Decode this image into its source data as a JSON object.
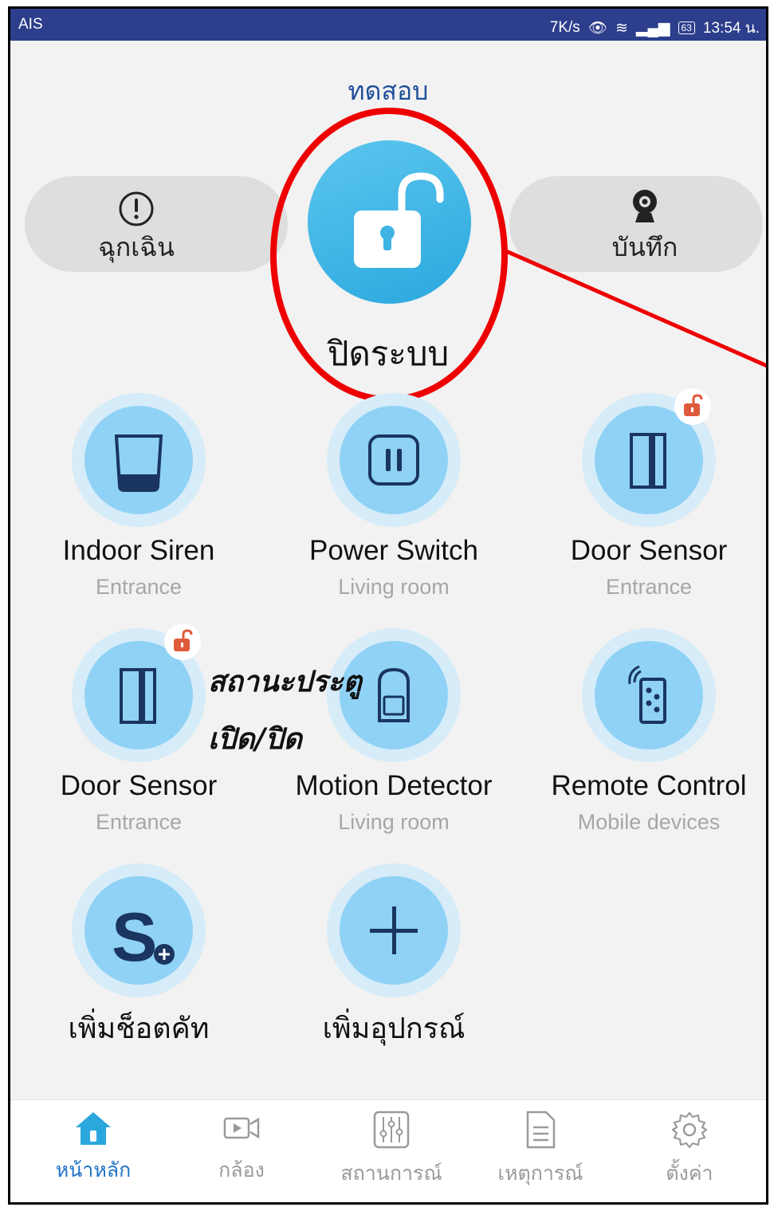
{
  "statusbar": {
    "carrier": "AIS",
    "speed": "7K/s",
    "battery": "63",
    "time": "13:54 น."
  },
  "title": "ทดสอบ",
  "emergency_label": "ฉุกเฉิน",
  "record_label": "บันทึก",
  "arm_label": "ปิดระบบ",
  "devices": [
    {
      "name": "Indoor Siren",
      "room": "Entrance"
    },
    {
      "name": "Power Switch",
      "room": "Living room"
    },
    {
      "name": "Door Sensor",
      "room": "Entrance"
    },
    {
      "name": "Door Sensor",
      "room": "Entrance"
    },
    {
      "name": "Motion Detector",
      "room": "Living room"
    },
    {
      "name": "Remote Control",
      "room": "Mobile devices"
    }
  ],
  "add_shortcut_label": "เพิ่มช็อตคัท",
  "add_device_label": "เพิ่มอุปกรณ์",
  "annotation": {
    "line1": "สถานะประตู",
    "line2": "เปิด/ปิด"
  },
  "nav": [
    {
      "label": "หน้าหลัก",
      "icon": "home-icon",
      "active": true
    },
    {
      "label": "กล้อง",
      "icon": "camera-icon",
      "active": false
    },
    {
      "label": "สถานการณ์",
      "icon": "scenario-icon",
      "active": false
    },
    {
      "label": "เหตุการณ์",
      "icon": "event-icon",
      "active": false
    },
    {
      "label": "ตั้งค่า",
      "icon": "settings-icon",
      "active": false
    }
  ],
  "colors": {
    "accent": "#1f73c9",
    "status_bar": "#2c3e8c",
    "device_disc": "#8fd2f6",
    "annotation_red": "#e00000"
  }
}
